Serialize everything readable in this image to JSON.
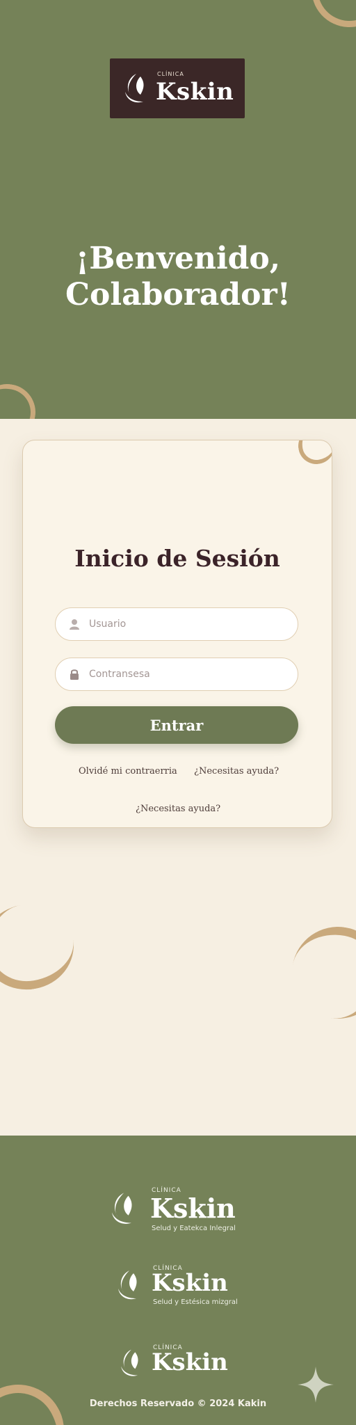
{
  "brand": {
    "small_label": "CLÍNICA",
    "name": "Kskin"
  },
  "hero": {
    "title_line1": "¡Benvenido,",
    "title_line2": "Colaborador!"
  },
  "login": {
    "title": "Inicio de Sesión",
    "username_placeholder": "Usuario",
    "password_placeholder": "Contransesa",
    "submit_label": "Entrar",
    "forgot_link": "Olvidé mi contraerria",
    "help_link_inline": "¿Necesitas ayuda?",
    "help_link_bottom": "¿Necesitas ayuda?"
  },
  "footer": {
    "logos": [
      {
        "small": "CLÍNICA",
        "name": "Kskin",
        "tagline": "Selud y Eatekca Inlegral"
      },
      {
        "small": "CLÍNICA",
        "name": "Kskin",
        "tagline": "Selud y Estésica mizgral"
      },
      {
        "small": "CLÍNICA",
        "name": "Kskin",
        "tagline": ""
      }
    ],
    "copyright": "Derechos Reservado © 2024 Kakin"
  },
  "colors": {
    "olive": "#758258",
    "button": "#6e7a54",
    "cream": "#f6efe2",
    "gold": "#c9a97c",
    "brown": "#3b2727",
    "title": "#3b2329"
  },
  "icons": [
    "leaf-logo-icon",
    "user-icon",
    "lock-icon",
    "sparkle-icon"
  ]
}
